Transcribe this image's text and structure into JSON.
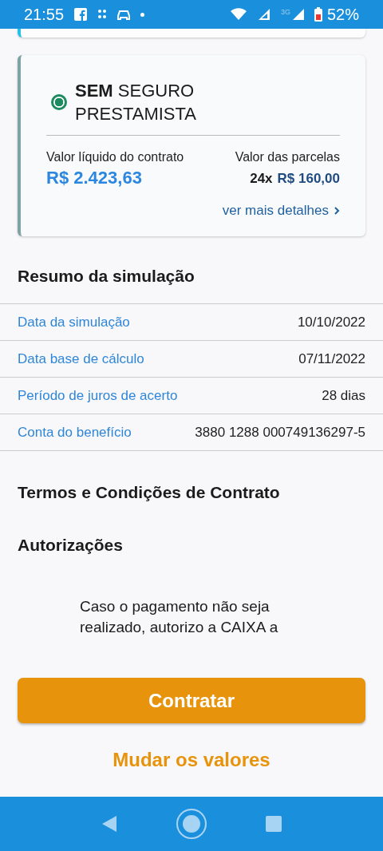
{
  "status_bar": {
    "time": "21:55",
    "network_label": "3G",
    "battery": "52%"
  },
  "option_card": {
    "selected": true,
    "title": "**SEM** SEGURO PRESTAMISTA",
    "net_label": "Valor líquido do contrato",
    "net_value": "R$ 2.423,63",
    "installments_label": "Valor das parcelas",
    "installments_count": "24x",
    "installment_value": "R$ 160,00",
    "details_link": "ver mais detalhes"
  },
  "summary": {
    "title": "Resumo da simulação",
    "rows": [
      {
        "label": "Data da simulação",
        "value": "10/10/2022"
      },
      {
        "label": "Data base de cálculo",
        "value": "07/11/2022"
      },
      {
        "label": "Período de juros de acerto",
        "value": "28 dias"
      },
      {
        "label": "Conta do benefício",
        "value": "3880 1288 000749136297-5"
      }
    ]
  },
  "terms_title": "Termos e Condições de Contrato",
  "authorizations": {
    "title": "Autorizações",
    "text": "Caso o pagamento não seja realizado, autorizo a CAIXA a"
  },
  "primary_button": "Contratar",
  "secondary_button": "Mudar os valores"
}
